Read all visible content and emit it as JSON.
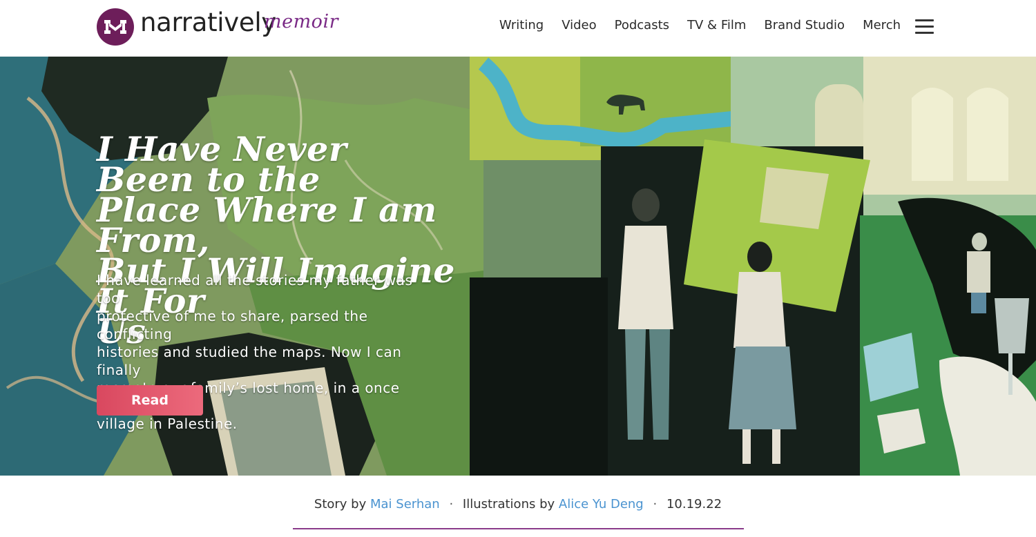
{
  "header": {
    "logo_text": "narratively",
    "section_label": "memoir",
    "nav": [
      "Writing",
      "Video",
      "Podcasts",
      "TV & Film",
      "Brand Studio",
      "Merch"
    ]
  },
  "hero": {
    "title_lines": [
      "I Have Never Been to the",
      "Place Where I am From,",
      "But I Will Imagine It For",
      "Us"
    ],
    "dek_lines": [
      "I have learned all the stories my father was too",
      "protective of me to share, parsed the conflicting",
      "histories and studied the maps. Now I can finally",
      "recreate our family’s lost home, in a once small",
      "village in Palestine."
    ],
    "read_label": "Read"
  },
  "byline": {
    "story_prefix": "Story by",
    "author": "Mai Serhan",
    "sep": "·",
    "illus_prefix": "Illustrations by",
    "illustrator": "Alice Yu Deng",
    "date": "10.19.22"
  },
  "colors": {
    "brand_purple": "#6d1e5a",
    "section_purple": "#7a2a86",
    "button_red": "#d9485f",
    "link_blue": "#4a93d0"
  },
  "icons": {
    "logo_mark": "narratively-n-logo-icon",
    "menu": "hamburger-menu-icon"
  }
}
